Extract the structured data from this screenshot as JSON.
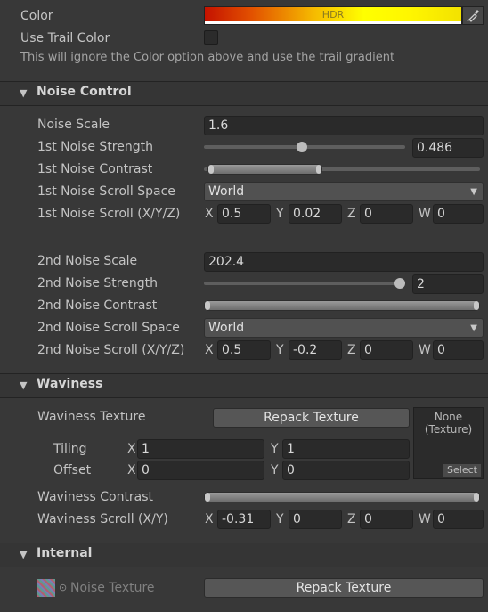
{
  "top": {
    "color_label": "Color",
    "color_hdr": "HDR",
    "use_trail_label": "Use Trail Color",
    "trail_help": "This will ignore the Color option above and use the trail gradient"
  },
  "noise": {
    "header": "Noise Control",
    "scale_label": "Noise Scale",
    "scale_value": "1.6",
    "strength1_label": "1st Noise Strength",
    "strength1_value": "0.486",
    "strength1_level": 0.486,
    "contrast1_label": "1st Noise Contrast",
    "space1_label": "1st Noise Scroll Space",
    "space1_value": "World",
    "scroll1_label": "1st Noise Scroll (X/Y/Z)",
    "scroll1": {
      "x": "0.5",
      "y": "0.02",
      "z": "0",
      "w": "0"
    },
    "scale2_label": "2nd Noise Scale",
    "scale2_value": "202.4",
    "strength2_label": "2nd Noise Strength",
    "strength2_value": "2",
    "contrast2_label": "2nd Noise Contrast",
    "space2_label": "2nd Noise Scroll Space",
    "space2_value": "World",
    "scroll2_label": "2nd Noise Scroll (X/Y/Z)",
    "scroll2": {
      "x": "0.5",
      "y": "-0.2",
      "z": "0",
      "w": "0"
    }
  },
  "axes": {
    "x": "X",
    "y": "Y",
    "z": "Z",
    "w": "W"
  },
  "waviness": {
    "header": "Waviness",
    "texture_label": "Waviness Texture",
    "repack_label": "Repack Texture",
    "slot_none": "None",
    "slot_type": "(Texture)",
    "slot_select": "Select",
    "tiling_label": "Tiling",
    "tiling": {
      "x": "1",
      "y": "1"
    },
    "offset_label": "Offset",
    "offset": {
      "x": "0",
      "y": "0"
    },
    "contrast_label": "Waviness Contrast",
    "scroll_label": "Waviness Scroll (X/Y)",
    "scroll": {
      "x": "-0.31",
      "y": "0",
      "z": "0",
      "w": "0"
    }
  },
  "internal": {
    "header": "Internal",
    "noise_texture_label": "Noise Texture",
    "repack_label": "Repack Texture"
  },
  "colors": {
    "background": "#383838",
    "header": "#353535",
    "field": "#2a2a2a",
    "button": "#565656"
  }
}
